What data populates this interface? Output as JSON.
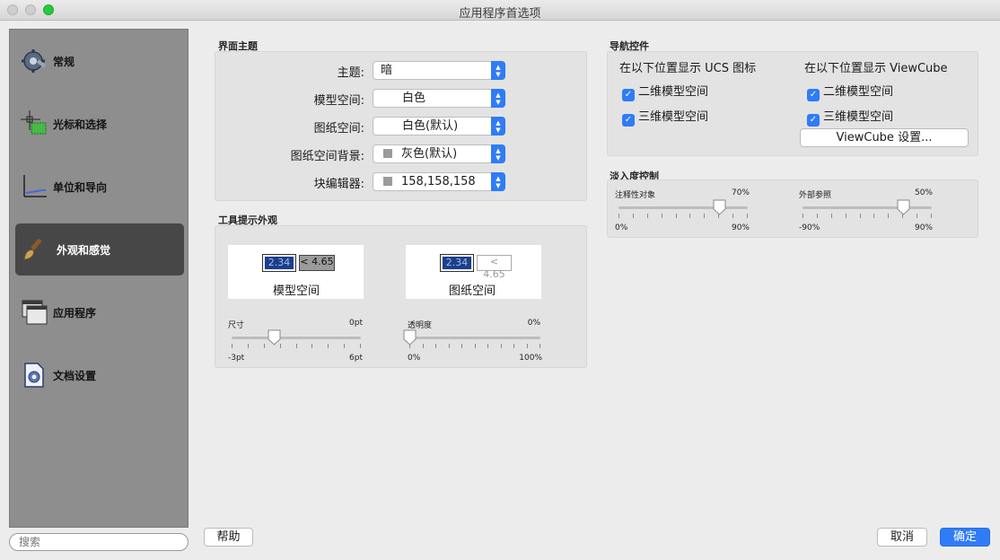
{
  "window": {
    "title": "应用程序首选项"
  },
  "sidebar": {
    "items": [
      {
        "label": "常规",
        "icon": "gear-wrench-icon"
      },
      {
        "label": "光标和选择",
        "icon": "crosshair-icon"
      },
      {
        "label": "单位和导向",
        "icon": "axes-icon"
      },
      {
        "label": "外观和感觉",
        "icon": "paintbrush-icon",
        "active": true
      },
      {
        "label": "应用程序",
        "icon": "windows-icon"
      },
      {
        "label": "文档设置",
        "icon": "document-icon"
      }
    ],
    "search_placeholder": "搜索"
  },
  "theme": {
    "title": "界面主题",
    "rows": [
      {
        "label": "主题:",
        "value": "暗"
      },
      {
        "label": "模型空间:",
        "value": "白色"
      },
      {
        "label": "图纸空间:",
        "value": "白色(默认)"
      },
      {
        "label": "图纸空间背景:",
        "value": "灰色(默认)"
      },
      {
        "label": "块编辑器:",
        "value": "158,158,158"
      }
    ]
  },
  "tooltip": {
    "title": "工具提示外观",
    "model_preview": {
      "val1": "2.34",
      "val2": "< 4.65",
      "caption": "模型空间"
    },
    "paper_preview": {
      "val1": "2.34",
      "val2": "< 4.65",
      "caption": "图纸空间"
    },
    "size_slider": {
      "label": "尺寸",
      "value_text": "0pt",
      "min": "-3pt",
      "max": "6pt",
      "position": 0.333
    },
    "transparency_slider": {
      "label": "透明度",
      "value_text": "0%",
      "min": "0%",
      "max": "100%",
      "position": 0.0
    }
  },
  "nav": {
    "title": "导航控件",
    "ucs_header": "在以下位置显示 UCS 图标",
    "ucs_items": [
      "二维模型空间",
      "三维模型空间"
    ],
    "viewcube_header": "在以下位置显示 ViewCube",
    "viewcube_items": [
      "二维模型空间",
      "三维模型空间"
    ],
    "viewcube_button": "ViewCube 设置..."
  },
  "fade": {
    "title": "淡入度控制",
    "annotation": {
      "label": "注释性对象",
      "value_text": "70%",
      "min": "0%",
      "max": "90%",
      "position": 0.778
    },
    "xref": {
      "label": "外部参照",
      "value_text": "50%",
      "min": "-90%",
      "max": "90%",
      "position": 0.778
    }
  },
  "footer": {
    "help": "帮助",
    "cancel": "取消",
    "ok": "确定"
  },
  "colors": {
    "accent": "#2f7cf6",
    "sidebar_bg": "#8e8e8e",
    "sidebar_active": "#474747"
  }
}
